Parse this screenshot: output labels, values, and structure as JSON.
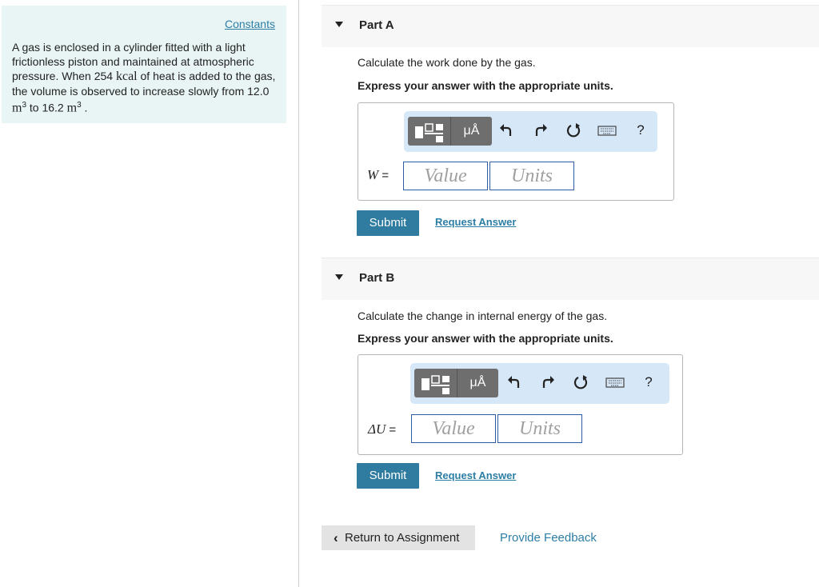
{
  "left": {
    "constants_link": "Constants",
    "problem": {
      "part1": "A gas is enclosed in a cylinder fitted with a light frictionless piston and maintained at atmospheric pressure. When 254 ",
      "unit_kcal": "kcal",
      "part2": " of heat is added to the gas, the volume is observed to increase slowly from 12.0 ",
      "unit_m": "m",
      "exp": "3",
      "part3": " to 16.2 ",
      "end": " ."
    }
  },
  "partA": {
    "title": "Part A",
    "instruction": "Calculate the work done by the gas.",
    "express": "Express your answer with the appropriate units.",
    "toolbar": {
      "units_label": "μÅ",
      "help": "?"
    },
    "variable": "W",
    "equals": " =",
    "value_placeholder": "Value",
    "units_placeholder": "Units",
    "submit": "Submit",
    "request": "Request Answer"
  },
  "partB": {
    "title": "Part B",
    "instruction": "Calculate the change in internal energy of the gas.",
    "express": "Express your answer with the appropriate units.",
    "toolbar": {
      "units_label": "μÅ",
      "help": "?"
    },
    "variable": "ΔU",
    "equals": " =",
    "value_placeholder": "Value",
    "units_placeholder": "Units",
    "submit": "Submit",
    "request": "Request Answer"
  },
  "footer": {
    "return_label": "Return to Assignment",
    "feedback_label": "Provide Feedback"
  },
  "colors": {
    "accent": "#2f7ca0",
    "link": "#2d7ea5",
    "panel": "#e9f5f5",
    "toolbar": "#d6e7f8"
  }
}
